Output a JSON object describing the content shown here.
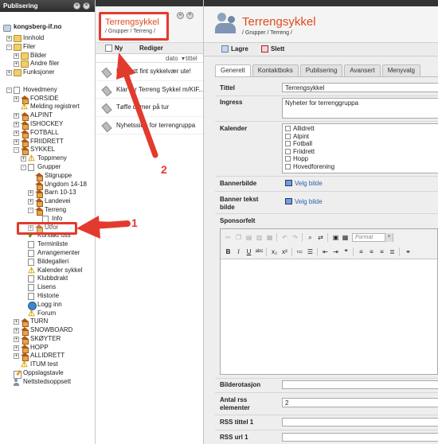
{
  "tree": {
    "header": "Publisering",
    "site": "kongsberg-if.no",
    "items": [
      {
        "label": "Innhold",
        "indent": 1,
        "exp": "+",
        "icon": "folder"
      },
      {
        "label": "Filer",
        "indent": 1,
        "exp": "-",
        "icon": "folder"
      },
      {
        "label": "Bilder",
        "indent": 2,
        "exp": "+",
        "icon": "folder"
      },
      {
        "label": "Andre filer",
        "indent": 2,
        "exp": "+",
        "icon": "folder"
      },
      {
        "label": "Funksjoner",
        "indent": 1,
        "exp": "+",
        "icon": "folder"
      },
      {
        "label": "",
        "indent": 0,
        "exp": "",
        "icon": "none"
      },
      {
        "label": "Hovedmeny",
        "indent": 1,
        "exp": "-",
        "icon": "page"
      },
      {
        "label": "FORSIDE",
        "indent": 2,
        "exp": "+",
        "icon": "house"
      },
      {
        "label": "Melding registrert",
        "indent": 2,
        "exp": "",
        "icon": "warn"
      },
      {
        "label": "ALPINT",
        "indent": 2,
        "exp": "+",
        "icon": "house"
      },
      {
        "label": "ISHOCKEY",
        "indent": 2,
        "exp": "+",
        "icon": "house"
      },
      {
        "label": "FOTBALL",
        "indent": 2,
        "exp": "+",
        "icon": "house"
      },
      {
        "label": "FRIIDRETT",
        "indent": 2,
        "exp": "+",
        "icon": "house"
      },
      {
        "label": "SYKKEL",
        "indent": 2,
        "exp": "-",
        "icon": "house"
      },
      {
        "label": "Toppmeny",
        "indent": 3,
        "exp": "+",
        "icon": "warn"
      },
      {
        "label": "Grupper",
        "indent": 3,
        "exp": "-",
        "icon": "page"
      },
      {
        "label": "Stigruppe",
        "indent": 4,
        "exp": "",
        "icon": "house"
      },
      {
        "label": "Ungdom 14-18",
        "indent": 4,
        "exp": "",
        "icon": "house"
      },
      {
        "label": "Barn 10-13",
        "indent": 4,
        "exp": "+",
        "icon": "house"
      },
      {
        "label": "Landevei",
        "indent": 4,
        "exp": "+",
        "icon": "house"
      },
      {
        "label": "Terreng",
        "indent": 4,
        "exp": "-",
        "icon": "house"
      },
      {
        "label": "Info",
        "indent": 5,
        "exp": "",
        "icon": "page"
      },
      {
        "label": "Utfor",
        "indent": 4,
        "exp": "+",
        "icon": "house"
      },
      {
        "label": "Kontakt oss",
        "indent": 3,
        "exp": "",
        "icon": "check"
      },
      {
        "label": "Terminliste",
        "indent": 3,
        "exp": "",
        "icon": "page"
      },
      {
        "label": "Arrangementer",
        "indent": 3,
        "exp": "",
        "icon": "page"
      },
      {
        "label": "Bildegalleri",
        "indent": 3,
        "exp": "",
        "icon": "page"
      },
      {
        "label": "Kalender sykkel",
        "indent": 3,
        "exp": "",
        "icon": "warn"
      },
      {
        "label": "Klubbdrakt",
        "indent": 3,
        "exp": "",
        "icon": "page"
      },
      {
        "label": "Lisens",
        "indent": 3,
        "exp": "",
        "icon": "page"
      },
      {
        "label": "Historie",
        "indent": 3,
        "exp": "",
        "icon": "page"
      },
      {
        "label": "Logg inn",
        "indent": 3,
        "exp": "",
        "icon": "globe"
      },
      {
        "label": "Forum",
        "indent": 3,
        "exp": "",
        "icon": "warn"
      },
      {
        "label": "TURN",
        "indent": 2,
        "exp": "+",
        "icon": "house"
      },
      {
        "label": "SNOWBOARD",
        "indent": 2,
        "exp": "+",
        "icon": "house"
      },
      {
        "label": "SKØYTER",
        "indent": 2,
        "exp": "+",
        "icon": "house"
      },
      {
        "label": "HOPP",
        "indent": 2,
        "exp": "+",
        "icon": "house"
      },
      {
        "label": "ALLIDRETT",
        "indent": 2,
        "exp": "+",
        "icon": "house"
      },
      {
        "label": "ITUM test",
        "indent": 2,
        "exp": "",
        "icon": "warn"
      },
      {
        "label": "Oppslagstavle",
        "indent": 1,
        "exp": "",
        "icon": "pencil"
      },
      {
        "label": "Nettstedsoppsett",
        "indent": 1,
        "exp": "",
        "icon": "people"
      }
    ]
  },
  "list": {
    "title": "Terrengsykkel",
    "breadcrumb": "/ Grupper / Terreng /",
    "toolbar": {
      "new": "Ny",
      "edit": "Rediger"
    },
    "columns": {
      "date": "dato",
      "title": "tittel"
    },
    "rows": [
      "Fortsatt fint sykkelvær ute!",
      "Klar for Terreng Sykkel m/KIF...",
      "Tøffe damer på tur",
      "Nyhetsside for terrengruppa"
    ]
  },
  "edit": {
    "title": "Terrengsykkel",
    "breadcrumb": "/ Grupper / Terreng /",
    "toolbar": {
      "save": "Lagre",
      "delete": "Slett"
    },
    "tabs": [
      "Generelt",
      "Kontaktboks",
      "Publisering",
      "Avansert",
      "Menyvalg"
    ],
    "fields": {
      "tittel": {
        "label": "Tittel",
        "value": "Terrengsykkel"
      },
      "ingress": {
        "label": "Ingress",
        "value": "Nyheter for terrenggruppa"
      },
      "kalender": {
        "label": "Kalender",
        "options": [
          "Allidrett",
          "Alpint",
          "Fotball",
          "Friidrett",
          "Hopp",
          "Hovedforening"
        ]
      },
      "banner": {
        "label": "Bannerbilde",
        "link": "Velg bilde"
      },
      "banner_tekst": {
        "label": "Banner tekst bilde",
        "link": "Velg bilde"
      },
      "sponsor": {
        "label": "Sponsorfelt",
        "format_placeholder": "Format"
      },
      "bilderotasjon": {
        "label": "Bilderotasjon"
      },
      "antall_rss": {
        "label": "Antal rss elementer",
        "value": "2"
      },
      "rss_tittel": {
        "label": "RSS tittel 1"
      },
      "rss_url": {
        "label": "RSS url 1"
      }
    }
  },
  "annotations": {
    "one": "1",
    "two": "2"
  },
  "colors": {
    "annotation": "#e33a2e",
    "title": "#e04a1c"
  }
}
